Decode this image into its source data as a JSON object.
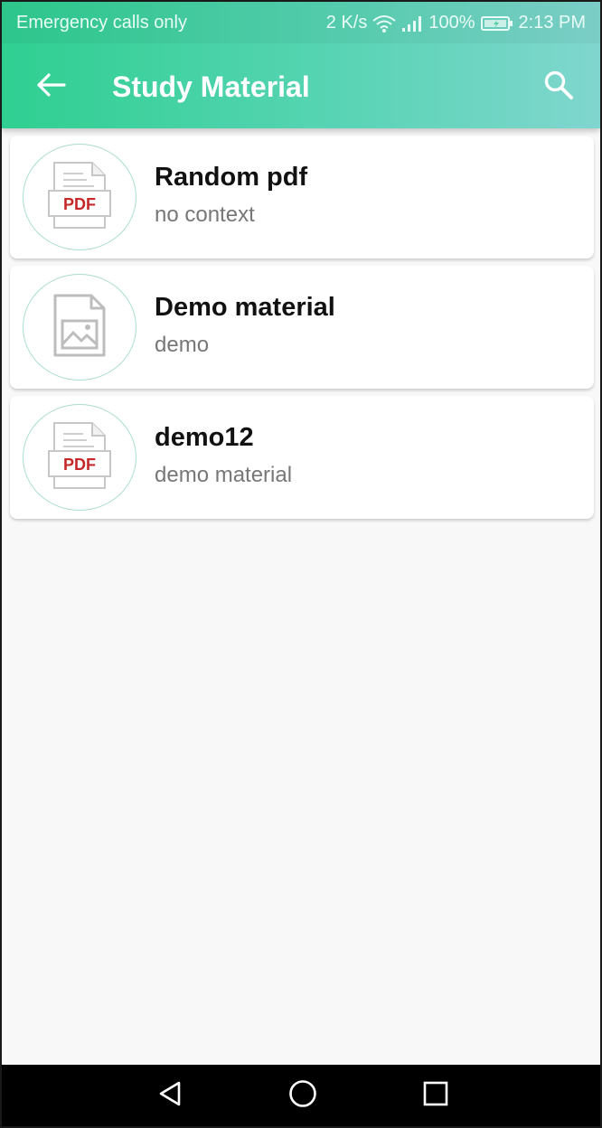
{
  "status_bar": {
    "carrier_text": "Emergency calls only",
    "net_speed": "2 K/s",
    "battery": "100%",
    "time": "2:13 PM",
    "icons": [
      "wifi-icon",
      "signal-icon",
      "battery-icon"
    ]
  },
  "app_bar": {
    "title": "Study Material",
    "back_icon": "arrow-left-icon",
    "search_icon": "search-icon"
  },
  "items": [
    {
      "title": "Random pdf",
      "subtitle": "no context",
      "file_type": "PDF",
      "icon": "pdf-file-icon"
    },
    {
      "title": "Demo material",
      "subtitle": "demo",
      "file_type": "image",
      "icon": "image-file-icon"
    },
    {
      "title": "demo12",
      "subtitle": "demo material",
      "file_type": "PDF",
      "icon": "pdf-file-icon"
    }
  ],
  "nav_bar": {
    "icons": [
      "back-triangle-icon",
      "home-circle-icon",
      "recents-square-icon"
    ]
  },
  "colors": {
    "accent_start": "#2fcf91",
    "accent_end": "#80d6ce",
    "pdf_label": "#c62828"
  }
}
